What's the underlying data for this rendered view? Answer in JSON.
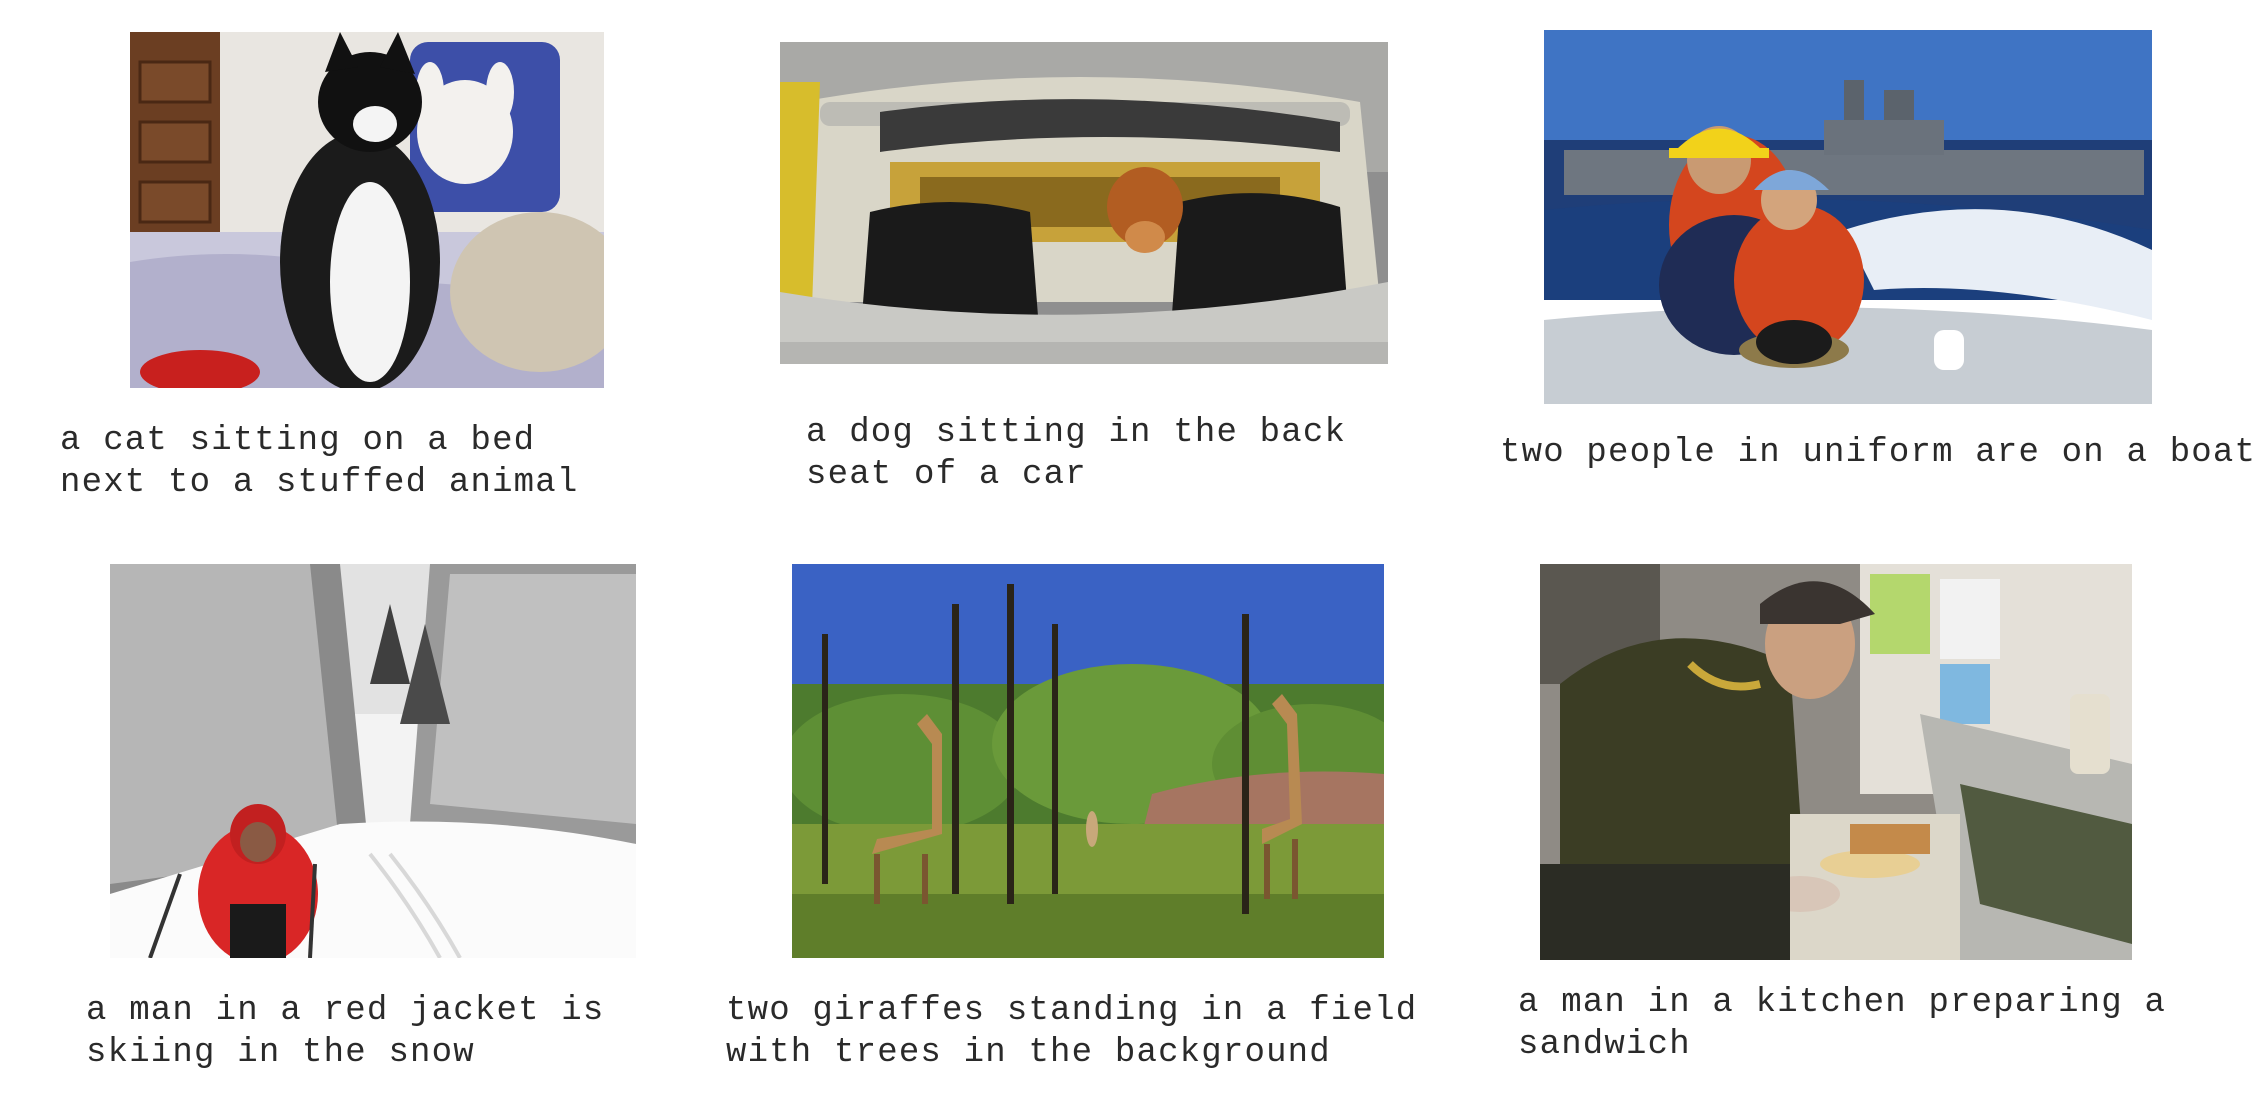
{
  "grid": {
    "items": [
      {
        "image": "cat-on-bed-photo",
        "caption_lines": [
          "a cat sitting on a bed",
          "next to a stuffed animal"
        ]
      },
      {
        "image": "dog-in-convertible-photo",
        "caption_lines": [
          "a dog sitting in the back",
          "seat of a car"
        ]
      },
      {
        "image": "people-on-boat-photo",
        "caption_lines": [
          "two people in uniform are on a boat"
        ]
      },
      {
        "image": "skier-in-snow-photo",
        "caption_lines": [
          "a man in a red jacket is",
          "skiing in the snow"
        ]
      },
      {
        "image": "giraffes-in-field-photo",
        "caption_lines": [
          "two giraffes standing in a field",
          "with trees in the background"
        ]
      },
      {
        "image": "man-in-kitchen-photo",
        "caption_lines": [
          "a man in a kitchen preparing a",
          "sandwich"
        ]
      }
    ]
  }
}
